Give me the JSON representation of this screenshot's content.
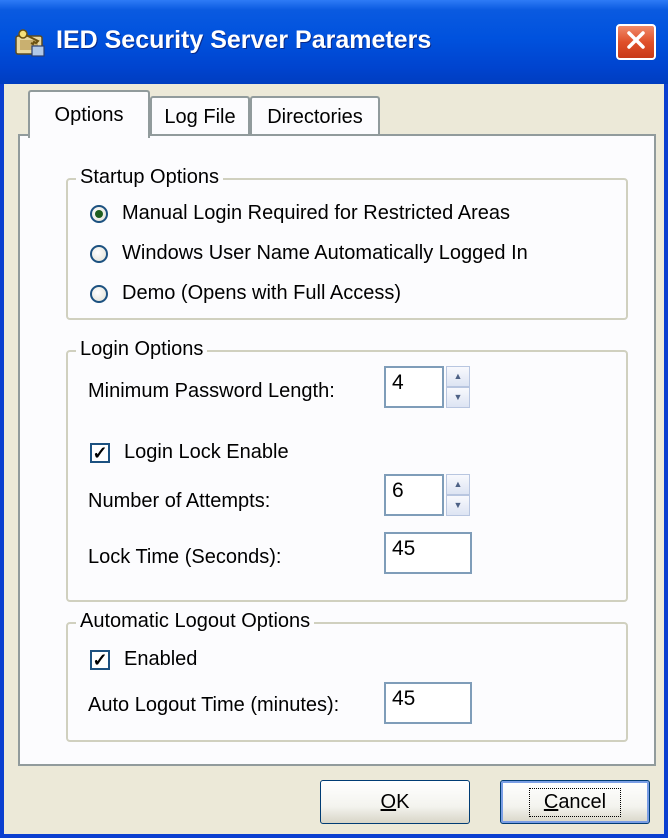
{
  "window": {
    "title": "IED Security Server Parameters",
    "icon": "security-key-icon",
    "close_icon": "close-icon"
  },
  "tabs": [
    {
      "label": "Options",
      "selected": true
    },
    {
      "label": "Log File",
      "selected": false
    },
    {
      "label": "Directories",
      "selected": false
    }
  ],
  "startup": {
    "legend": "Startup Options",
    "options": [
      {
        "label": "Manual Login Required for Restricted Areas",
        "selected": true
      },
      {
        "label": "Windows User Name Automatically Logged In",
        "selected": false
      },
      {
        "label": "Demo (Opens with Full Access)",
        "selected": false
      }
    ]
  },
  "login": {
    "legend": "Login Options",
    "min_password_label": "Minimum Password Length:",
    "min_password_value": "4",
    "lock_enable_label": "Login Lock Enable",
    "lock_enable_checked": true,
    "attempts_label": "Number of Attempts:",
    "attempts_value": "6",
    "lock_time_label": "Lock Time (Seconds):",
    "lock_time_value": "45"
  },
  "logout": {
    "legend": "Automatic Logout Options",
    "enabled_label": "Enabled",
    "enabled_checked": true,
    "time_label": "Auto Logout Time (minutes):",
    "time_value": "45"
  },
  "buttons": {
    "ok_accel": "O",
    "ok_rest": "K",
    "cancel_accel": "C",
    "cancel_rest": "ancel"
  },
  "colors": {
    "titlebar": "#0052de",
    "dialog_bg": "#ece9d8",
    "panel_bg": "#fcfcfe",
    "close_button": "#e0502a"
  }
}
